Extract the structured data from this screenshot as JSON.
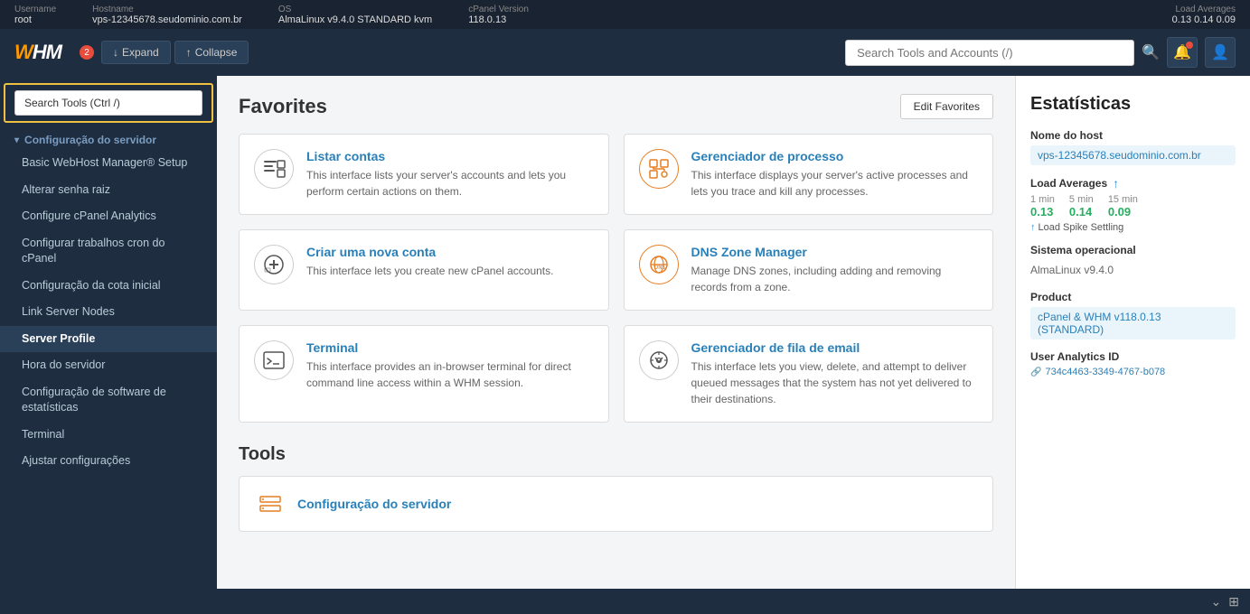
{
  "topbar": {
    "username_label": "Username",
    "username_value": "root",
    "hostname_label": "Hostname",
    "hostname_value": "vps-12345678.seudominio.com.br",
    "os_label": "OS",
    "os_value": "AlmaLinux v9.4.0 STANDARD kvm",
    "cpanel_label": "cPanel Version",
    "cpanel_value": "118.0.13",
    "load_label": "Load Averages",
    "load_values": "0.13  0.14  0.09"
  },
  "header": {
    "logo": "WHM",
    "expand_label": "Expand",
    "collapse_label": "Collapse",
    "badge": "2",
    "search_placeholder": "Search Tools and Accounts (/)"
  },
  "sidebar": {
    "search_placeholder": "Search Tools (Ctrl /)",
    "search_current": "Search Tools (Ctrl /)",
    "items": [
      {
        "label": "Configuração do servidor",
        "indent": false,
        "parent": true
      },
      {
        "label": "Basic WebHost Manager® Setup",
        "indent": true
      },
      {
        "label": "Alterar senha raiz",
        "indent": true
      },
      {
        "label": "Configure cPanel Analytics",
        "indent": true
      },
      {
        "label": "Configurar trabalhos cron do cPanel",
        "indent": true
      },
      {
        "label": "Configuração da cota inicial",
        "indent": true
      },
      {
        "label": "Link Server Nodes",
        "indent": true
      },
      {
        "label": "Server Profile",
        "indent": true,
        "active": true
      },
      {
        "label": "Hora do servidor",
        "indent": true
      },
      {
        "label": "Configuração de software de estatísticas",
        "indent": true
      },
      {
        "label": "Terminal",
        "indent": true
      },
      {
        "label": "Ajustar configurações",
        "indent": true
      }
    ]
  },
  "favorites": {
    "title": "Favorites",
    "edit_button": "Edit Favorites",
    "cards": [
      {
        "title": "Listar contas",
        "description": "This interface lists your server's accounts and lets you perform certain actions on them.",
        "icon_type": "list"
      },
      {
        "title": "Gerenciador de processo",
        "description": "This interface displays your server's active processes and lets you trace and kill any processes.",
        "icon_type": "process"
      },
      {
        "title": "Criar uma nova conta",
        "description": "This interface lets you create new cPanel accounts.",
        "icon_type": "plus"
      },
      {
        "title": "DNS Zone Manager",
        "description": "Manage DNS zones, including adding and removing records from a zone.",
        "icon_type": "dns"
      },
      {
        "title": "Terminal",
        "description": "This interface provides an in-browser terminal for direct command line access within a WHM session.",
        "icon_type": "terminal"
      },
      {
        "title": "Gerenciador de fila de email",
        "description": "This interface lets you view, delete, and attempt to deliver queued messages that the system has not yet delivered to their destinations.",
        "icon_type": "email"
      }
    ]
  },
  "tools": {
    "title": "Tools",
    "items": [
      {
        "label": "Configuração do servidor",
        "icon_type": "server"
      }
    ]
  },
  "stats": {
    "title": "Estatísticas",
    "hostname_label": "Nome do host",
    "hostname_value": "vps-12345678.seudominio.com.br",
    "load_label": "Load Averages",
    "load_1min_label": "1 min",
    "load_5min_label": "5 min",
    "load_15min_label": "15 min",
    "load_1min": "0.13",
    "load_5min": "0.14",
    "load_15min": "0.09",
    "load_spike": "Load Spike Settling",
    "os_label": "Sistema operacional",
    "os_value": "AlmaLinux v9.4.0",
    "product_label": "Product",
    "product_value": "cPanel & WHM v118.0.13 (STANDARD)",
    "analytics_label": "User Analytics ID",
    "analytics_value": "734c4463-3349-4767-b078"
  }
}
